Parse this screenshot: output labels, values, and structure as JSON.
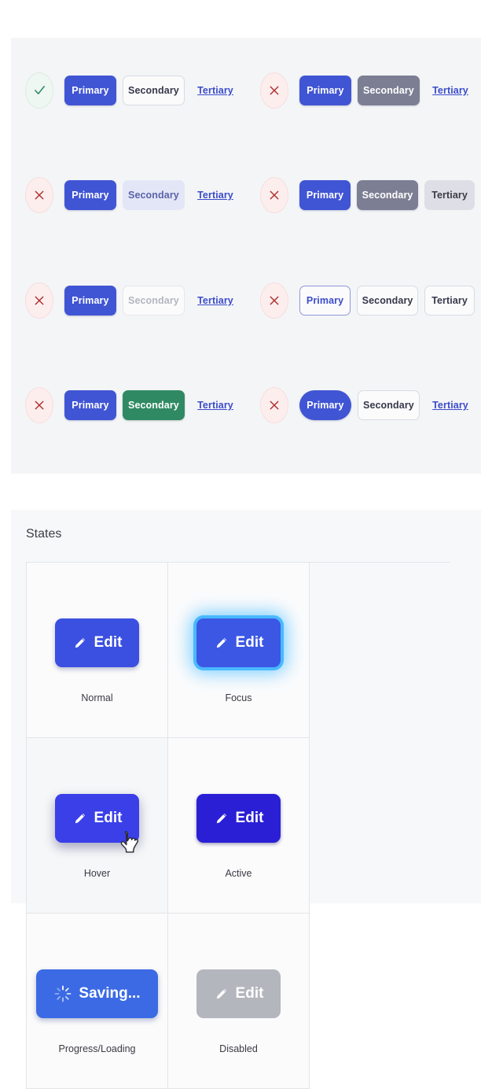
{
  "variants": {
    "rows": [
      {
        "left": {
          "status_icon": "check-icon",
          "status": "ok",
          "primary": "Primary",
          "secondary": "Secondary",
          "tertiary": "Tertiary"
        },
        "right": {
          "status_icon": "cross-icon",
          "status": "bad",
          "primary": "Primary",
          "secondary": "Secondary",
          "tertiary": "Tertiary"
        }
      },
      {
        "left": {
          "status_icon": "cross-icon",
          "status": "bad",
          "primary": "Primary",
          "secondary": "Secondary",
          "tertiary": "Tertiary"
        },
        "right": {
          "status_icon": "cross-icon",
          "status": "bad",
          "primary": "Primary",
          "secondary": "Secondary",
          "tertiary": "Tertiary"
        }
      },
      {
        "left": {
          "status_icon": "cross-icon",
          "status": "bad",
          "primary": "Primary",
          "secondary": "Secondary",
          "tertiary": "Tertiary"
        },
        "right": {
          "status_icon": "cross-icon",
          "status": "bad",
          "primary": "Primary",
          "secondary": "Secondary",
          "tertiary": "Tertiary"
        }
      },
      {
        "left": {
          "status_icon": "cross-icon",
          "status": "bad",
          "primary": "Primary",
          "secondary": "Secondary",
          "tertiary": "Tertiary"
        },
        "right": {
          "status_icon": "cross-icon",
          "status": "bad",
          "primary": "Primary",
          "secondary": "Secondary",
          "tertiary": "Tertiary"
        }
      }
    ]
  },
  "states": {
    "title": "States",
    "cells": [
      {
        "button_label": "Edit",
        "label": "Normal",
        "icon": "pencil-icon"
      },
      {
        "button_label": "Edit",
        "label": "Focus",
        "icon": "pencil-icon"
      },
      {
        "button_label": "Edit",
        "label": "Hover",
        "icon": "pencil-icon"
      },
      {
        "button_label": "Edit",
        "label": "Active",
        "icon": "pencil-icon"
      },
      {
        "button_label": "Saving...",
        "label": "Progress/Loading",
        "icon": "spinner-icon"
      },
      {
        "button_label": "Edit",
        "label": "Disabled",
        "icon": "pencil-icon"
      }
    ]
  },
  "colors": {
    "primary": "#4055d4",
    "primary_deep": "#2f23d8",
    "grey": "#7c7f93",
    "lavender": "#e3e6f6",
    "green": "#2f8a63",
    "light_grey": "#dedfe6",
    "link": "#3b4cca",
    "focus_glow": "#49b8ff",
    "disabled": "#b4b6be",
    "panel_bg": "#f4f5f7",
    "ok": "#2f8a63",
    "bad": "#b03030"
  }
}
